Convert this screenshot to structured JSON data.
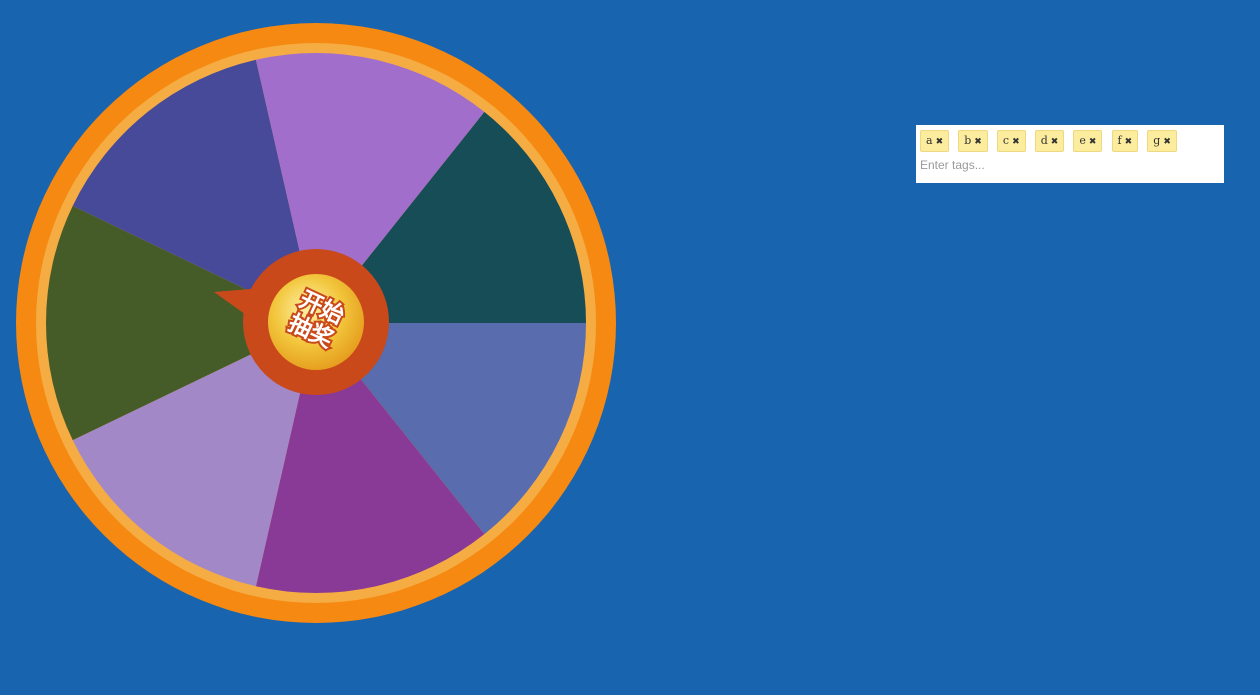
{
  "wheel": {
    "colors": {
      "outer_ring": "#f68912",
      "inner_ring": "#f5ac43",
      "pointer": "#c9491a",
      "button_gold": "#f2c63c",
      "button_text": "#ffffff",
      "button_text_outline": "#c9491a"
    },
    "segments": [
      {
        "color": "#164d57"
      },
      {
        "color": "#586cae"
      },
      {
        "color": "#893a96"
      },
      {
        "color": "#a388c7"
      },
      {
        "color": "#465c28"
      },
      {
        "color": "#474a98"
      },
      {
        "color": "#a16ecc"
      }
    ],
    "start_button": {
      "label_line1": "开始",
      "label_line2": "抽奖"
    }
  },
  "tags_input": {
    "tags": [
      {
        "text": "a",
        "remove": "✖"
      },
      {
        "text": "b",
        "remove": "✖"
      },
      {
        "text": "c",
        "remove": "✖"
      },
      {
        "text": "d",
        "remove": "✖"
      },
      {
        "text": "e",
        "remove": "✖"
      },
      {
        "text": "f",
        "remove": "✖"
      },
      {
        "text": "g",
        "remove": "✖"
      }
    ],
    "placeholder": "Enter tags...",
    "value": ""
  },
  "colors": {
    "background": "#1864ae",
    "tag_background": "#fbec9e",
    "tag_border": "#eed980"
  }
}
